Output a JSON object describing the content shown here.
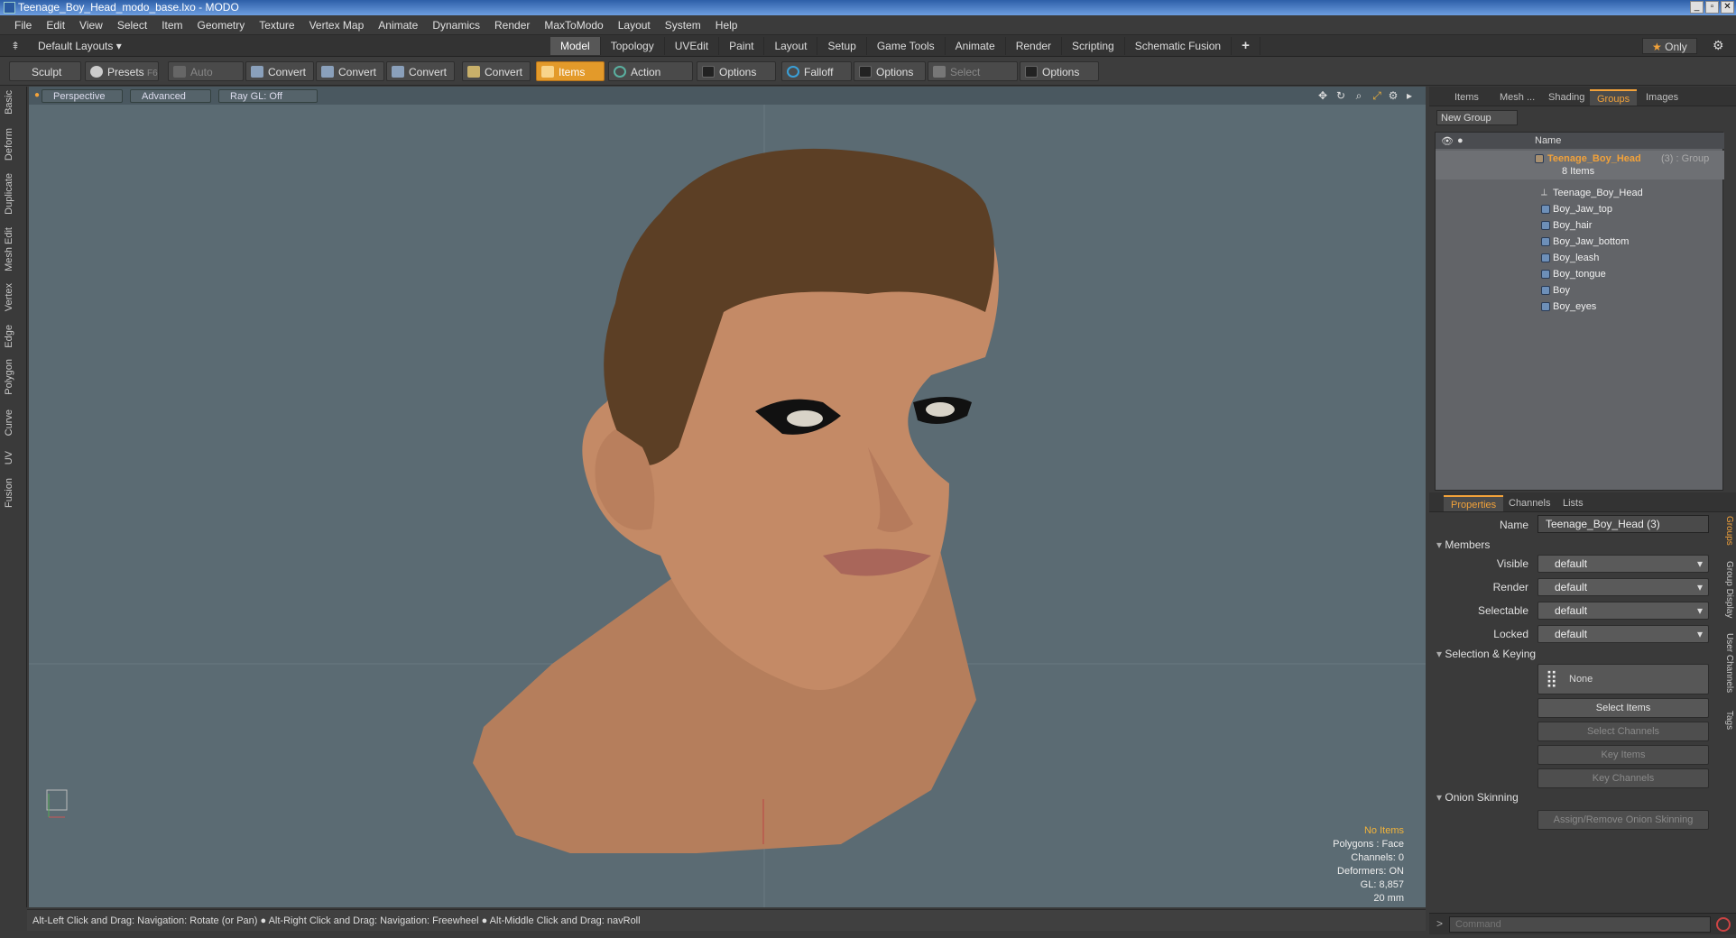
{
  "window": {
    "title": "Teenage_Boy_Head_modo_base.lxo - MODO",
    "minimize": "_",
    "restore": "▫",
    "close": "✕"
  },
  "menu": [
    "File",
    "Edit",
    "View",
    "Select",
    "Item",
    "Geometry",
    "Texture",
    "Vertex Map",
    "Animate",
    "Dynamics",
    "Render",
    "MaxToModo",
    "Layout",
    "System",
    "Help"
  ],
  "layoutbar": {
    "layouts": "Default Layouts",
    "tabs": [
      "Model",
      "Topology",
      "UVEdit",
      "Paint",
      "Layout",
      "Setup",
      "Game Tools",
      "Animate",
      "Render",
      "Scripting",
      "Schematic Fusion"
    ],
    "active": "Model",
    "add": "+",
    "only": "Only"
  },
  "toolbar": {
    "sculpt": "Sculpt",
    "presets": "Presets",
    "presets_key": "F6",
    "auto_select": "Auto Select",
    "convert": "Convert",
    "items": "Items",
    "action_center": "Action Center",
    "options": "Options",
    "falloff": "Falloff",
    "select_through": "Select Through"
  },
  "left_tabs": [
    "Basic",
    "Deform",
    "Duplicate",
    "Mesh Edit",
    "Vertex",
    "Edge",
    "Polygon",
    "Curve",
    "UV",
    "Fusion"
  ],
  "viewport": {
    "view": "Perspective",
    "advanced": "Advanced",
    "raygl": "Ray GL: Off",
    "stats": {
      "items": "No Items",
      "polygons": "Polygons : Face",
      "channels": "Channels: 0",
      "deformers": "Deformers: ON",
      "gl": "GL: 8,857",
      "scale": "20 mm"
    }
  },
  "statusbar": "Alt-Left Click and Drag: Navigation: Rotate (or Pan) ● Alt-Right Click and Drag: Navigation: Freewheel ● Alt-Middle Click and Drag: navRoll",
  "groups_panel": {
    "tabs": [
      "Items",
      "Mesh ...",
      "Shading",
      "Groups",
      "Images"
    ],
    "active": "Groups",
    "new_group": "New Group",
    "col_name": "Name",
    "group": {
      "name": "Teenage_Boy_Head",
      "suffix": "(3) : Group",
      "count": "8 Items"
    },
    "members": [
      "Teenage_Boy_Head",
      "Boy_Jaw_top",
      "Boy_hair",
      "Boy_Jaw_bottom",
      "Boy_leash",
      "Boy_tongue",
      "Boy",
      "Boy_eyes"
    ]
  },
  "properties": {
    "tabs": [
      "Properties",
      "Channels",
      "Lists"
    ],
    "active": "Properties",
    "name_label": "Name",
    "name_value": "Teenage_Boy_Head (3)",
    "members_section": "Members",
    "fields": [
      {
        "label": "Visible",
        "value": "default"
      },
      {
        "label": "Render",
        "value": "default"
      },
      {
        "label": "Selectable",
        "value": "default"
      },
      {
        "label": "Locked",
        "value": "default"
      }
    ],
    "sel_section": "Selection & Keying",
    "none": "None",
    "select_items": "Select Items",
    "select_channels": "Select Channels",
    "key_items": "Key Items",
    "key_channels": "Key Channels",
    "onion_section": "Onion Skinning",
    "assign_onion": "Assign/Remove Onion Skinning",
    "side_tabs": [
      "Groups",
      "Group Display",
      "User Channels",
      "Tags"
    ]
  },
  "command": {
    "placeholder": "Command",
    "prompt": ">"
  }
}
